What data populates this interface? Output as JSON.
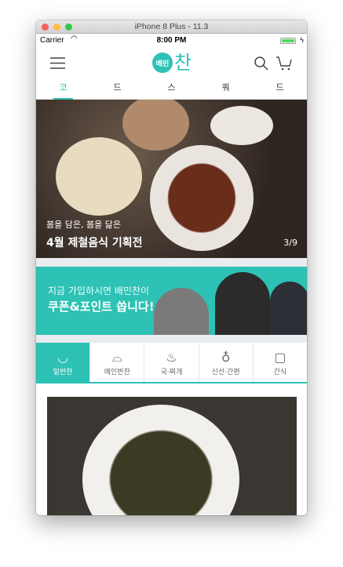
{
  "window": {
    "title": "iPhone 8 Plus - 11.3"
  },
  "status": {
    "carrier": "Carrier",
    "time": "8:00 PM"
  },
  "header": {
    "logo_badge": "배민",
    "logo_text": "찬"
  },
  "tabs": [
    {
      "label": "코",
      "active": true
    },
    {
      "label": "드"
    },
    {
      "label": "스"
    },
    {
      "label": "쿼"
    },
    {
      "label": "드"
    }
  ],
  "hero": {
    "subtitle": "봄을 담은, 봄을 닮은",
    "title": "4월 제철음식 기획전",
    "page": "3/9"
  },
  "banner": {
    "line1": "지금 가입하시면 배민찬이",
    "line2": "쿠폰&포인트 쏩니다!",
    "go": "go"
  },
  "categories": [
    {
      "label": "밑반찬",
      "icon": "rice-bowl-icon",
      "active": true
    },
    {
      "label": "메인반찬",
      "icon": "cloche-icon"
    },
    {
      "label": "국·찌개",
      "icon": "soup-bowl-icon"
    },
    {
      "label": "신선·간편",
      "icon": "peach-icon"
    },
    {
      "label": "간식",
      "icon": "jar-icon"
    }
  ],
  "colors": {
    "accent": "#2ec1b5"
  }
}
